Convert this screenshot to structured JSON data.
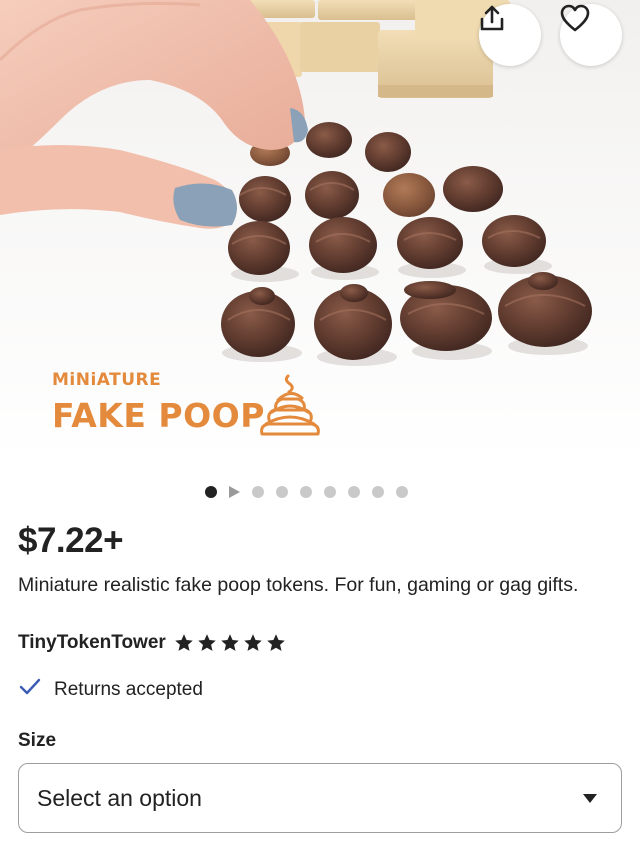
{
  "hero": {
    "title_small": "MiNiATURE",
    "title_big": "FAKE POOP",
    "emoji_icon": "poop-pile-icon",
    "accent_color": "#e48a3c"
  },
  "actions": {
    "share_icon": "share-icon",
    "favorite_icon": "heart-icon"
  },
  "carousel": {
    "total_images": 8,
    "active_index": 0,
    "has_video": true
  },
  "listing": {
    "price": "$7.22+",
    "description": "Miniature realistic fake poop tokens. For fun, gaming or gag gifts.",
    "shop_name": "TinyTokenTower",
    "rating_stars": 5,
    "returns_text": "Returns accepted",
    "check_color": "#3b5bb5"
  },
  "variation": {
    "label": "Size",
    "selected": "Select an option"
  }
}
